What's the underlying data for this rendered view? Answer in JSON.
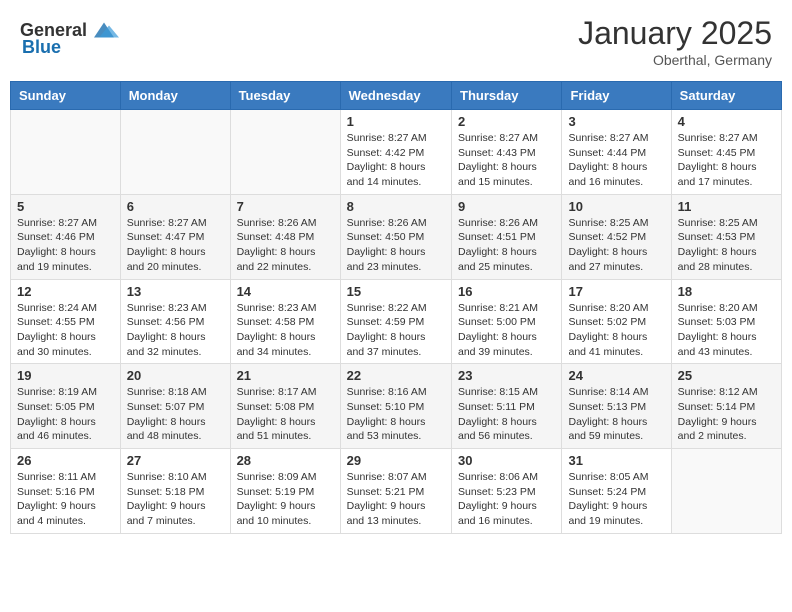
{
  "header": {
    "logo_general": "General",
    "logo_blue": "Blue",
    "month_title": "January 2025",
    "location": "Oberthal, Germany"
  },
  "days_of_week": [
    "Sunday",
    "Monday",
    "Tuesday",
    "Wednesday",
    "Thursday",
    "Friday",
    "Saturday"
  ],
  "weeks": [
    [
      {
        "day": "",
        "info": ""
      },
      {
        "day": "",
        "info": ""
      },
      {
        "day": "",
        "info": ""
      },
      {
        "day": "1",
        "info": "Sunrise: 8:27 AM\nSunset: 4:42 PM\nDaylight: 8 hours\nand 14 minutes."
      },
      {
        "day": "2",
        "info": "Sunrise: 8:27 AM\nSunset: 4:43 PM\nDaylight: 8 hours\nand 15 minutes."
      },
      {
        "day": "3",
        "info": "Sunrise: 8:27 AM\nSunset: 4:44 PM\nDaylight: 8 hours\nand 16 minutes."
      },
      {
        "day": "4",
        "info": "Sunrise: 8:27 AM\nSunset: 4:45 PM\nDaylight: 8 hours\nand 17 minutes."
      }
    ],
    [
      {
        "day": "5",
        "info": "Sunrise: 8:27 AM\nSunset: 4:46 PM\nDaylight: 8 hours\nand 19 minutes."
      },
      {
        "day": "6",
        "info": "Sunrise: 8:27 AM\nSunset: 4:47 PM\nDaylight: 8 hours\nand 20 minutes."
      },
      {
        "day": "7",
        "info": "Sunrise: 8:26 AM\nSunset: 4:48 PM\nDaylight: 8 hours\nand 22 minutes."
      },
      {
        "day": "8",
        "info": "Sunrise: 8:26 AM\nSunset: 4:50 PM\nDaylight: 8 hours\nand 23 minutes."
      },
      {
        "day": "9",
        "info": "Sunrise: 8:26 AM\nSunset: 4:51 PM\nDaylight: 8 hours\nand 25 minutes."
      },
      {
        "day": "10",
        "info": "Sunrise: 8:25 AM\nSunset: 4:52 PM\nDaylight: 8 hours\nand 27 minutes."
      },
      {
        "day": "11",
        "info": "Sunrise: 8:25 AM\nSunset: 4:53 PM\nDaylight: 8 hours\nand 28 minutes."
      }
    ],
    [
      {
        "day": "12",
        "info": "Sunrise: 8:24 AM\nSunset: 4:55 PM\nDaylight: 8 hours\nand 30 minutes."
      },
      {
        "day": "13",
        "info": "Sunrise: 8:23 AM\nSunset: 4:56 PM\nDaylight: 8 hours\nand 32 minutes."
      },
      {
        "day": "14",
        "info": "Sunrise: 8:23 AM\nSunset: 4:58 PM\nDaylight: 8 hours\nand 34 minutes."
      },
      {
        "day": "15",
        "info": "Sunrise: 8:22 AM\nSunset: 4:59 PM\nDaylight: 8 hours\nand 37 minutes."
      },
      {
        "day": "16",
        "info": "Sunrise: 8:21 AM\nSunset: 5:00 PM\nDaylight: 8 hours\nand 39 minutes."
      },
      {
        "day": "17",
        "info": "Sunrise: 8:20 AM\nSunset: 5:02 PM\nDaylight: 8 hours\nand 41 minutes."
      },
      {
        "day": "18",
        "info": "Sunrise: 8:20 AM\nSunset: 5:03 PM\nDaylight: 8 hours\nand 43 minutes."
      }
    ],
    [
      {
        "day": "19",
        "info": "Sunrise: 8:19 AM\nSunset: 5:05 PM\nDaylight: 8 hours\nand 46 minutes."
      },
      {
        "day": "20",
        "info": "Sunrise: 8:18 AM\nSunset: 5:07 PM\nDaylight: 8 hours\nand 48 minutes."
      },
      {
        "day": "21",
        "info": "Sunrise: 8:17 AM\nSunset: 5:08 PM\nDaylight: 8 hours\nand 51 minutes."
      },
      {
        "day": "22",
        "info": "Sunrise: 8:16 AM\nSunset: 5:10 PM\nDaylight: 8 hours\nand 53 minutes."
      },
      {
        "day": "23",
        "info": "Sunrise: 8:15 AM\nSunset: 5:11 PM\nDaylight: 8 hours\nand 56 minutes."
      },
      {
        "day": "24",
        "info": "Sunrise: 8:14 AM\nSunset: 5:13 PM\nDaylight: 8 hours\nand 59 minutes."
      },
      {
        "day": "25",
        "info": "Sunrise: 8:12 AM\nSunset: 5:14 PM\nDaylight: 9 hours\nand 2 minutes."
      }
    ],
    [
      {
        "day": "26",
        "info": "Sunrise: 8:11 AM\nSunset: 5:16 PM\nDaylight: 9 hours\nand 4 minutes."
      },
      {
        "day": "27",
        "info": "Sunrise: 8:10 AM\nSunset: 5:18 PM\nDaylight: 9 hours\nand 7 minutes."
      },
      {
        "day": "28",
        "info": "Sunrise: 8:09 AM\nSunset: 5:19 PM\nDaylight: 9 hours\nand 10 minutes."
      },
      {
        "day": "29",
        "info": "Sunrise: 8:07 AM\nSunset: 5:21 PM\nDaylight: 9 hours\nand 13 minutes."
      },
      {
        "day": "30",
        "info": "Sunrise: 8:06 AM\nSunset: 5:23 PM\nDaylight: 9 hours\nand 16 minutes."
      },
      {
        "day": "31",
        "info": "Sunrise: 8:05 AM\nSunset: 5:24 PM\nDaylight: 9 hours\nand 19 minutes."
      },
      {
        "day": "",
        "info": ""
      }
    ]
  ]
}
